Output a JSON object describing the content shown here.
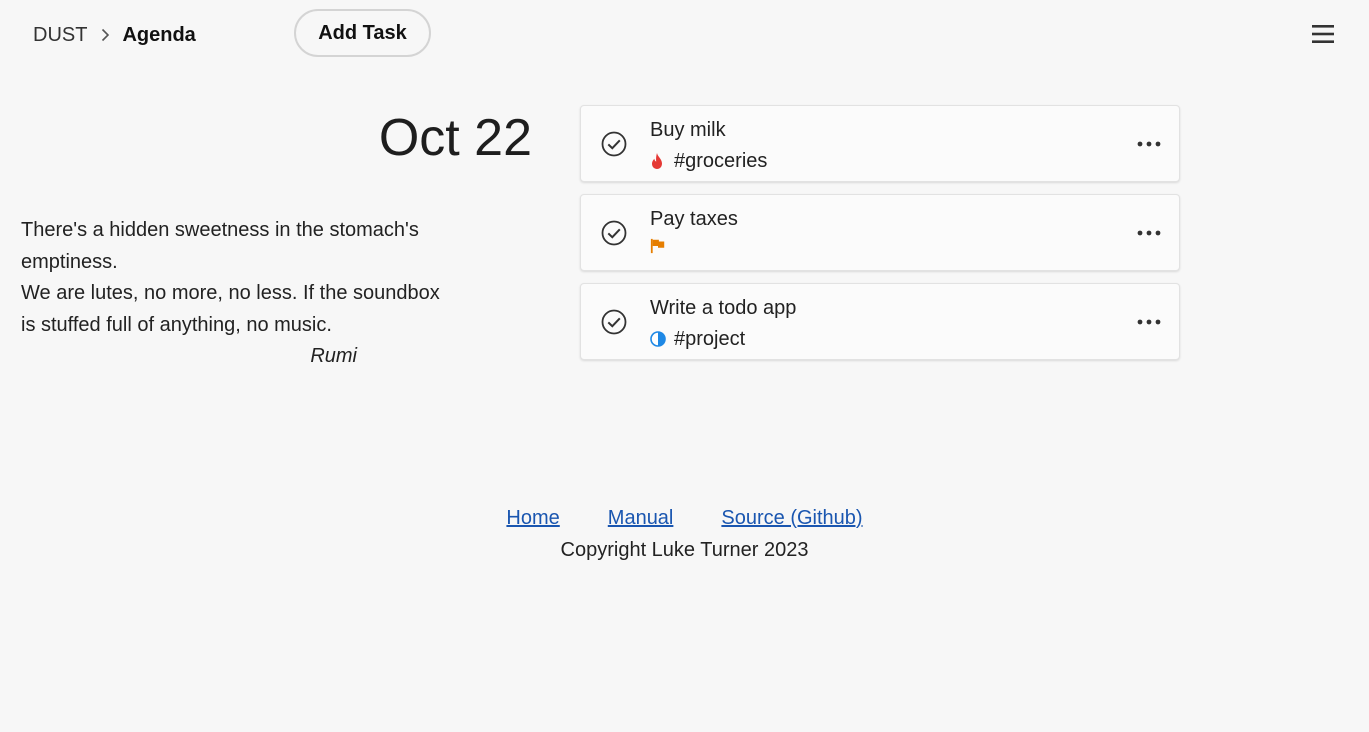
{
  "header": {
    "breadcrumb": {
      "root": "DUST",
      "current": "Agenda"
    },
    "add_task_label": "Add Task",
    "menu_icon": "hamburger-menu-icon"
  },
  "agenda": {
    "date": "Oct 22",
    "quote": {
      "line1": "There's a hidden sweetness in the stomach's",
      "line2": "emptiness.",
      "line3": "We are lutes, no more, no less. If the soundbox",
      "line4": "is stuffed full of anything, no music.",
      "author": "Rumi"
    }
  },
  "tasks": [
    {
      "title": "Buy milk",
      "icon": "flame-icon",
      "icon_color": "#e53935",
      "tag": "#groceries"
    },
    {
      "title": "Pay taxes",
      "icon": "flag-icon",
      "icon_color": "#e67e00",
      "tag": ""
    },
    {
      "title": "Write a todo app",
      "icon": "half-circle-icon",
      "icon_color": "#1e88e5",
      "tag": "#project"
    }
  ],
  "footer": {
    "links": [
      "Home",
      "Manual",
      "Source (Github)"
    ],
    "copyright": "Copyright Luke Turner 2023"
  },
  "colors": {
    "background": "#f7f7f7",
    "link": "#1a56b0"
  }
}
